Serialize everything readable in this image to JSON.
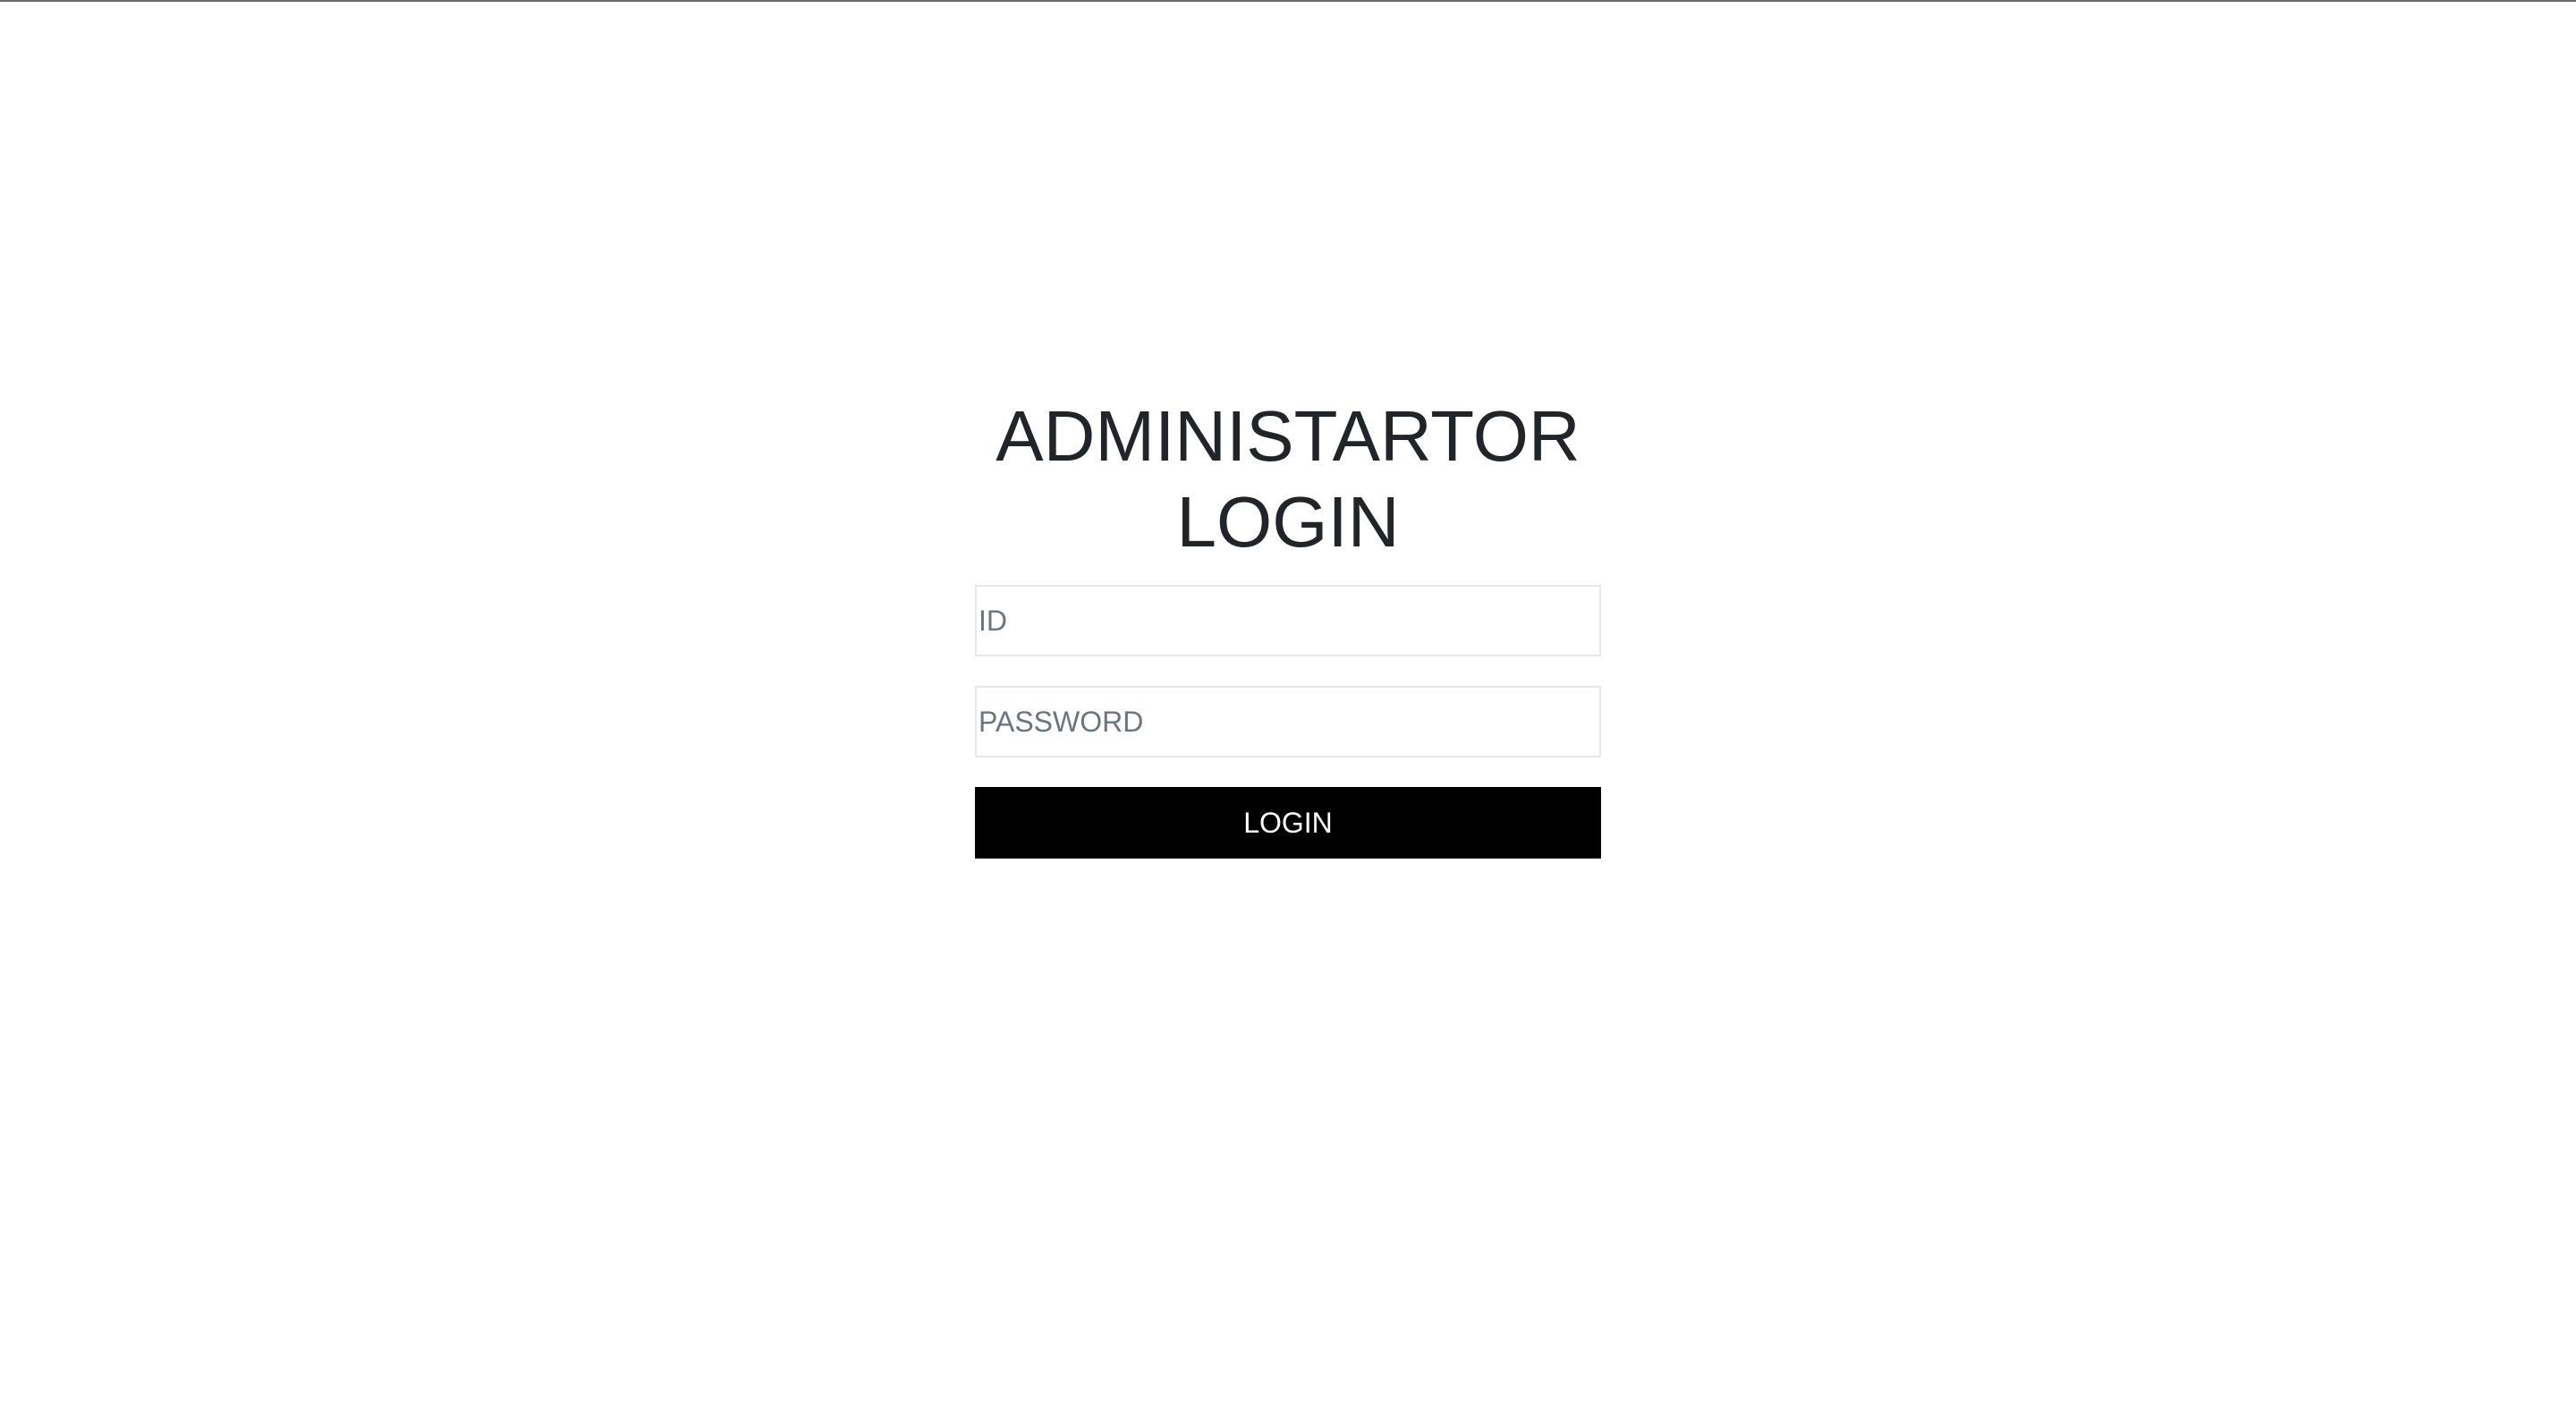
{
  "login": {
    "title_line1": "ADMINISTARTOR",
    "title_line2": "LOGIN",
    "id_placeholder": "ID",
    "password_placeholder": "PASSWORD",
    "submit_label": "LOGIN"
  }
}
